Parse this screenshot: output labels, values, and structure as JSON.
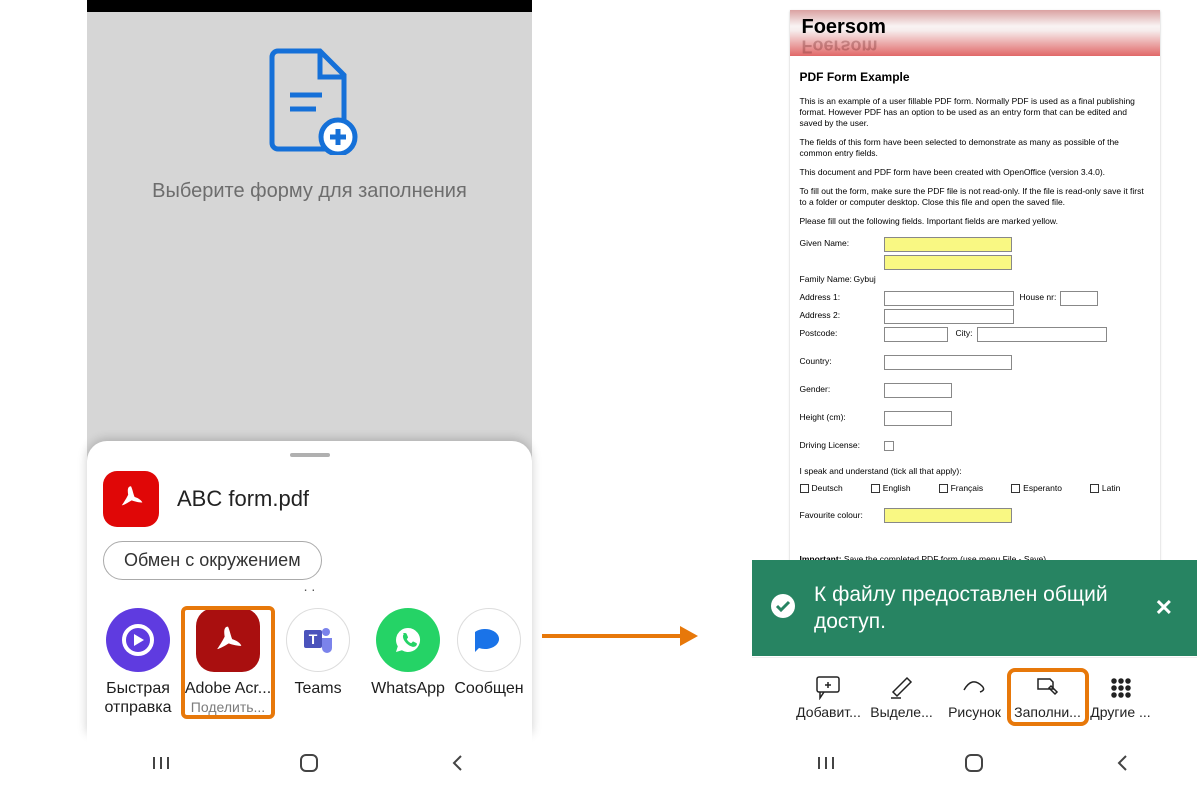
{
  "left": {
    "choose_text": "Выберите форму для заполнения",
    "file_name": "ABC form.pdf",
    "file_icon": "acrobat-icon",
    "share_surround": "Обмен с окружением",
    "apps": {
      "fast": {
        "label": "Быстрая\nотправка"
      },
      "acr": {
        "label": "Adobe Acr...",
        "sub": "Поделить..."
      },
      "teams": {
        "label": "Teams"
      },
      "wa": {
        "label": "WhatsApp"
      },
      "msg": {
        "label": "Сообщен"
      }
    }
  },
  "right": {
    "brand": "Foersom",
    "title": "PDF Form Example",
    "p1": "This is an example of a user fillable PDF form. Normally PDF is used as a final publishing format. However PDF has an option to be used as an entry form that can be edited and saved by the user.",
    "p2": "The fields of this form have been selected to demonstrate as many as possible of the common entry fields.",
    "p3": "This document and PDF form have been created with OpenOffice (version 3.4.0).",
    "p4": "To fill out the form, make sure the PDF file is not read-only. If the file is read-only save it first to a folder or computer desktop. Close this file and open the saved file.",
    "p5": "Please fill out the following fields. Important fields are marked yellow.",
    "labels": {
      "given": "Given Name:",
      "family": "Family Name:",
      "family_val": "Gybuj",
      "addr1": "Address 1:",
      "house": "House nr:",
      "addr2": "Address 2:",
      "post": "Postcode:",
      "city": "City:",
      "country": "Country:",
      "gender": "Gender:",
      "height": "Height (cm):",
      "dl": "Driving License:",
      "langs_title": "I speak and understand (tick all that apply):",
      "langs": {
        "de": "Deutsch",
        "en": "English",
        "fr": "Français",
        "eo": "Esperanto",
        "la": "Latin"
      },
      "fav": "Favourite colour:",
      "important_b": "Important:",
      "important": " Save the completed PDF form (use menu File - Save)."
    },
    "toast": "К файлу предоставлен общий доступ.",
    "tools": {
      "add": "Добавит...",
      "highlight": "Выделе...",
      "draw": "Рисунок",
      "fill": "Заполни...",
      "more": "Другие ..."
    }
  }
}
